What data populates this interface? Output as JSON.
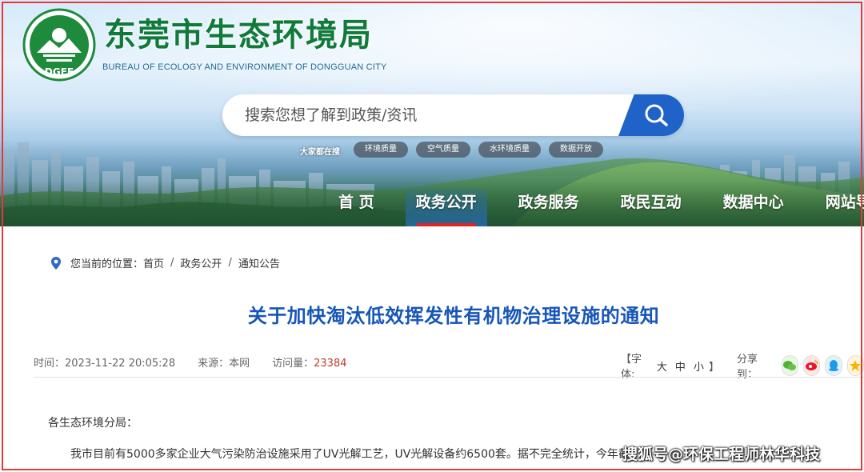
{
  "header": {
    "site_title": "东莞市生态环境局",
    "site_subtitle": "BUREAU OF ECOLOGY AND ENVIRONMENT OF DONGGUAN CITY",
    "logo_text": "DGEE",
    "brand_green": "#0f7a3a",
    "accent_blue": "#1f63c8"
  },
  "search": {
    "placeholder": "搜索您想了解到政策/资讯",
    "hot_label": "大家都在搜",
    "hot_tags": [
      "环境质量",
      "空气质量",
      "水环境质量",
      "数据开放"
    ]
  },
  "nav": {
    "items": [
      "首 页",
      "政务公开",
      "政务服务",
      "政民互动",
      "数据中心",
      "网站导"
    ],
    "active": "政务公开",
    "active_indicator_color": "#e02424"
  },
  "breadcrumb": {
    "prefix": "您当前的位置：",
    "items": [
      "首页",
      "政务公开",
      "通知公告"
    ],
    "separator": "/"
  },
  "article": {
    "title": "关于加快淘汰低效挥发性有机物治理设施的通知",
    "time_label": "时间：",
    "time": "2023-11-22 20:05:28",
    "source_label": "来源：",
    "source": "本网",
    "views_label": "访问量：",
    "views": "23384",
    "salutation": "各生态环境分局：",
    "paragraph": "我市目前有5000多家企业大气污染防治设施采用了UV光解工艺，UV光解设备约6500套。据不完全统计，今年截"
  },
  "tools": {
    "font_label": "【字体:",
    "font_sizes": [
      "大",
      "中",
      "小"
    ],
    "font_close": "】",
    "share_label": "分享到："
  },
  "watermark": "搜狐号@环保工程师林华科技"
}
